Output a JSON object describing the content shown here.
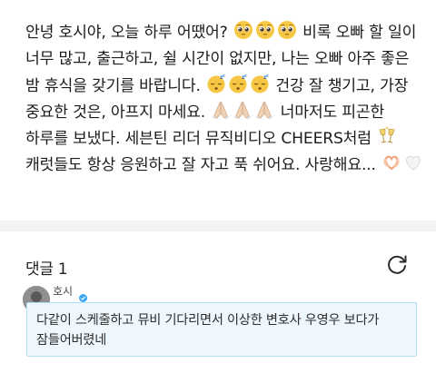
{
  "post": {
    "segments": [
      {
        "type": "text",
        "value": "안녕 호시야, 오늘 하루 어땠어? "
      },
      {
        "type": "emoji",
        "icon": "pleading-face-icon"
      },
      {
        "type": "emoji",
        "icon": "pleading-face-icon"
      },
      {
        "type": "emoji",
        "icon": "pleading-face-icon"
      },
      {
        "type": "text",
        "value": " 비록 오빠 할 일이 너무 많고, 출근하고, 쉴 시간이 없지만, 나는 오빠 아주 좋은 밤 휴식을 갖기를 바랍니다. "
      },
      {
        "type": "emoji",
        "icon": "sleeping-face-icon"
      },
      {
        "type": "emoji",
        "icon": "sleeping-face-icon"
      },
      {
        "type": "emoji",
        "icon": "sleeping-face-icon"
      },
      {
        "type": "text",
        "value": " 건강 잘 챙기고, 가장 중요한 것은, 아프지 마세요. "
      },
      {
        "type": "emoji",
        "icon": "folded-hands-icon"
      },
      {
        "type": "emoji",
        "icon": "folded-hands-icon"
      },
      {
        "type": "emoji",
        "icon": "folded-hands-icon"
      },
      {
        "type": "text",
        "value": " 너마저도 피곤한 하루를 보냈다. 세븐틴 리더 뮤직비디오 CHEERS처럼 "
      },
      {
        "type": "emoji",
        "icon": "clinking-glasses-icon"
      },
      {
        "type": "text",
        "value": " 캐럿들도 항상 응원하고 잘 자고 푹 쉬어요. 사랑해요... "
      },
      {
        "type": "emoji",
        "icon": "heart-hands-icon"
      },
      {
        "type": "emoji",
        "icon": "white-heart-icon"
      }
    ]
  },
  "comments": {
    "title": "댓글 1",
    "refresh_icon": "refresh-icon",
    "items": [
      {
        "username": "호시",
        "badge_icon": "verified-badge-icon",
        "text": "다같이 스케줄하고 뮤비 기다리면서 이상한 변호사 우영우 보다가 잠들어버렸네"
      }
    ]
  },
  "colors": {
    "divider": "#f3f3f5",
    "comment_bg": "#eef7fd",
    "comment_border": "#b8def7",
    "emoji_yellow": "#f7c744",
    "badge_blue": "#3ea6f2"
  }
}
